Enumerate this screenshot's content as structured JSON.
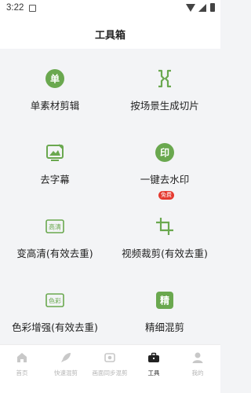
{
  "status_bar": {
    "time": "3:22"
  },
  "header": {
    "title": "工具箱"
  },
  "tools": [
    {
      "label": "单素材剪辑",
      "icon": "single-material-icon"
    },
    {
      "label": "按场景生成切片",
      "icon": "scene-slice-icon"
    },
    {
      "label": "去字幕",
      "icon": "remove-subtitle-icon"
    },
    {
      "label": "一键去水印",
      "icon": "remove-watermark-icon",
      "badge": "免费"
    },
    {
      "label": "变高清(有效去重)",
      "icon": "hd-icon",
      "icon_text": "高清"
    },
    {
      "label": "视频裁剪(有效去重)",
      "icon": "crop-icon"
    },
    {
      "label": "色彩增强(有效去重)",
      "icon": "color-enhance-icon",
      "icon_text": "色彩"
    },
    {
      "label": "精细混剪",
      "icon": "fine-mix-icon"
    }
  ],
  "nav": [
    {
      "label": "首页",
      "icon": "home-icon"
    },
    {
      "label": "快速混剪",
      "icon": "rocket-icon"
    },
    {
      "label": "画面同步混剪",
      "icon": "sync-icon"
    },
    {
      "label": "工具",
      "icon": "toolbox-icon",
      "active": true
    },
    {
      "label": "我的",
      "icon": "profile-icon"
    }
  ],
  "colors": {
    "accent": "#6aa84f",
    "badge": "#e5392f"
  }
}
